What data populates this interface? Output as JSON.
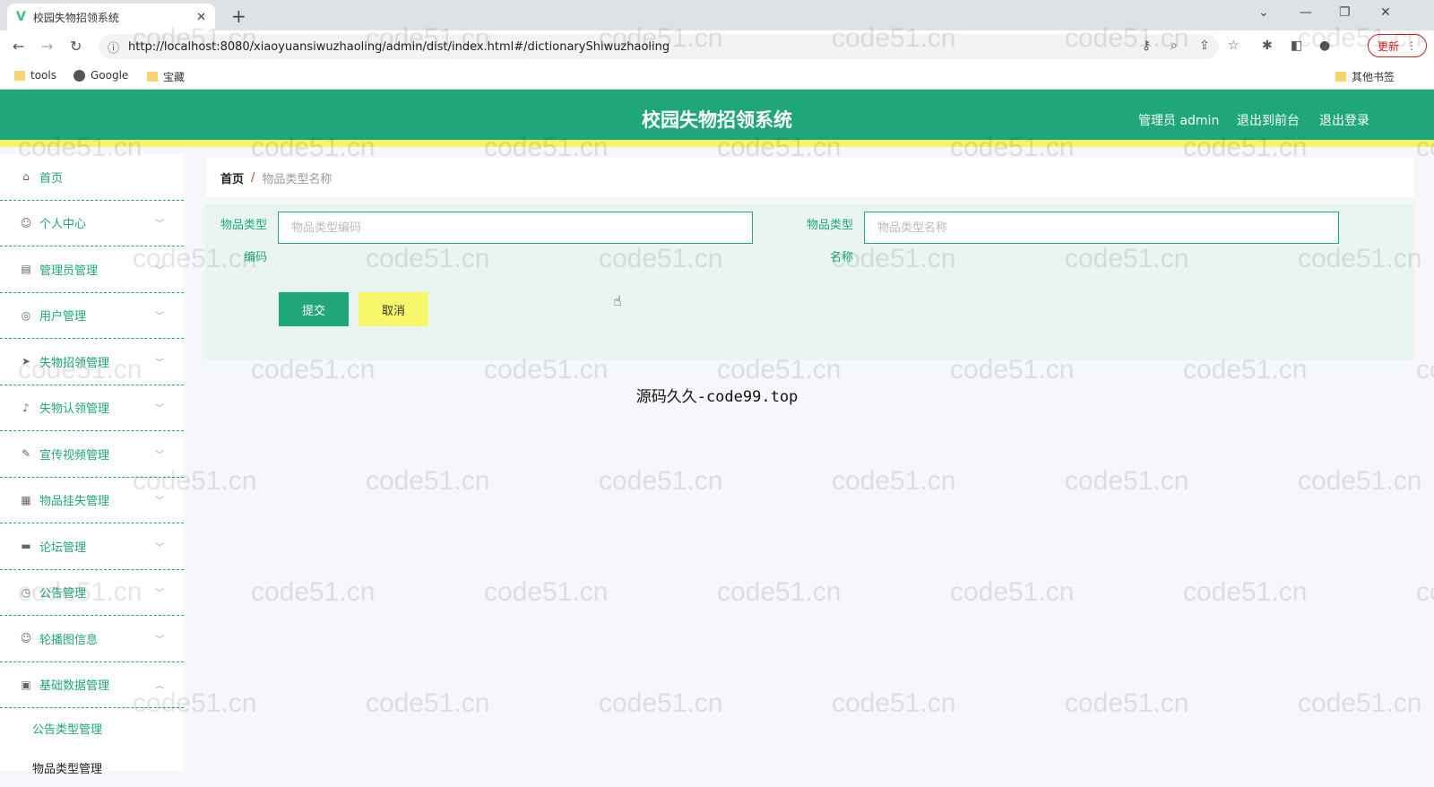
{
  "browser": {
    "tab_title": "校园失物招领系统",
    "favicon": "V",
    "url": "http://localhost:8080/xiaoyuansiwuzhaoling/admin/dist/index.html#/dictionaryShiwuzhaoling",
    "update_label": "更新",
    "bookmarks": [
      "tools",
      "Google",
      "宝藏"
    ],
    "other_bookmarks": "其他书签"
  },
  "header": {
    "title": "校园失物招领系统",
    "nav": [
      "管理员 admin",
      "退出到前台",
      "退出登录"
    ],
    "colors": {
      "primary": "#1fa67a",
      "accent": "#f5f56b"
    }
  },
  "sidebar": {
    "items": [
      {
        "label": "首页",
        "icon": "home-icon",
        "glyph": "⌂",
        "expandable": false
      },
      {
        "label": "个人中心",
        "icon": "user-icon",
        "glyph": "☺",
        "expandable": true
      },
      {
        "label": "管理员管理",
        "icon": "card-icon",
        "glyph": "▤",
        "expandable": true
      },
      {
        "label": "用户管理",
        "icon": "settings-icon",
        "glyph": "◎",
        "expandable": true
      },
      {
        "label": "失物招领管理",
        "icon": "send-icon",
        "glyph": "➤",
        "expandable": true
      },
      {
        "label": "失物认领管理",
        "icon": "microphone-icon",
        "glyph": "♪",
        "expandable": true
      },
      {
        "label": "宣传视频管理",
        "icon": "edit-icon",
        "glyph": "✎",
        "expandable": true
      },
      {
        "label": "物品挂失管理",
        "icon": "printer-icon",
        "glyph": "▦",
        "expandable": true
      },
      {
        "label": "论坛管理",
        "icon": "chat-icon",
        "glyph": "▬",
        "expandable": true
      },
      {
        "label": "公告管理",
        "icon": "clock-icon",
        "glyph": "◷",
        "expandable": true
      },
      {
        "label": "轮播图信息",
        "icon": "user-icon",
        "glyph": "☺",
        "expandable": true
      },
      {
        "label": "基础数据管理",
        "icon": "clipboard-icon",
        "glyph": "▣",
        "expandable": true,
        "expanded": true
      }
    ],
    "subitems": [
      {
        "label": "公告类型管理",
        "active": false
      },
      {
        "label": "物品类型管理",
        "active": true
      }
    ]
  },
  "breadcrumb": {
    "home": "首页",
    "separator": "/",
    "current": "物品类型名称"
  },
  "form": {
    "field1": {
      "label_line1": "物品类型",
      "label_line2": "编码",
      "placeholder": "物品类型编码",
      "value": ""
    },
    "field2": {
      "label_line1": "物品类型",
      "label_line2": "名称",
      "placeholder": "物品类型名称",
      "value": ""
    },
    "submit_label": "提交",
    "cancel_label": "取消"
  },
  "site_mark": "源码久久-code99.top",
  "watermark_text": "code51.cn"
}
